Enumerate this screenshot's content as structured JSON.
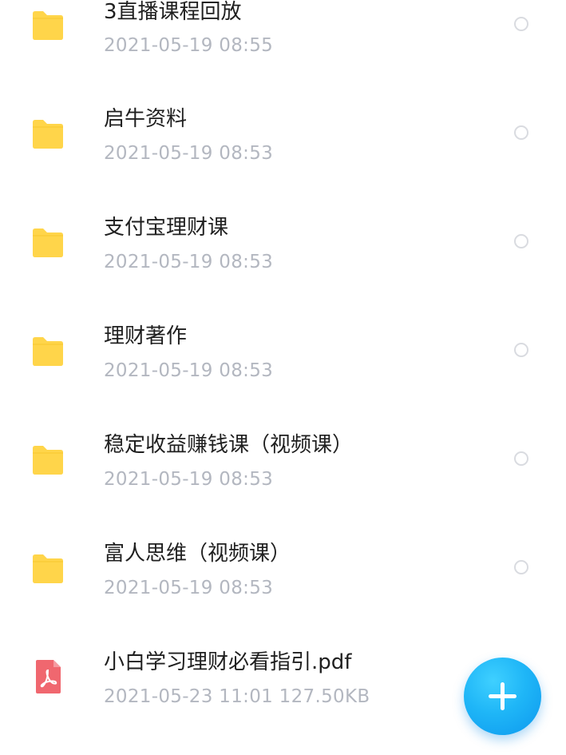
{
  "files": [
    {
      "name": "3直播课程回放",
      "meta": "2021-05-19  08:55",
      "type": "folder"
    },
    {
      "name": "启牛资料",
      "meta": "2021-05-19  08:53",
      "type": "folder"
    },
    {
      "name": "支付宝理财课",
      "meta": "2021-05-19  08:53",
      "type": "folder"
    },
    {
      "name": "理财著作",
      "meta": "2021-05-19  08:53",
      "type": "folder"
    },
    {
      "name": "稳定收益赚钱课（视频课）",
      "meta": "2021-05-19  08:53",
      "type": "folder"
    },
    {
      "name": "富人思维（视频课）",
      "meta": "2021-05-19  08:53",
      "type": "folder"
    },
    {
      "name": "小白学习理财必看指引.pdf",
      "meta": "2021-05-23  11:01   127.50KB",
      "type": "pdf"
    }
  ],
  "colors": {
    "folder": "#ffd54a",
    "pdf": "#f0676f",
    "fab": "#1fb6f7"
  },
  "icons": {
    "folder": "folder-icon",
    "pdf": "pdf-file-icon",
    "fab": "plus-icon"
  }
}
